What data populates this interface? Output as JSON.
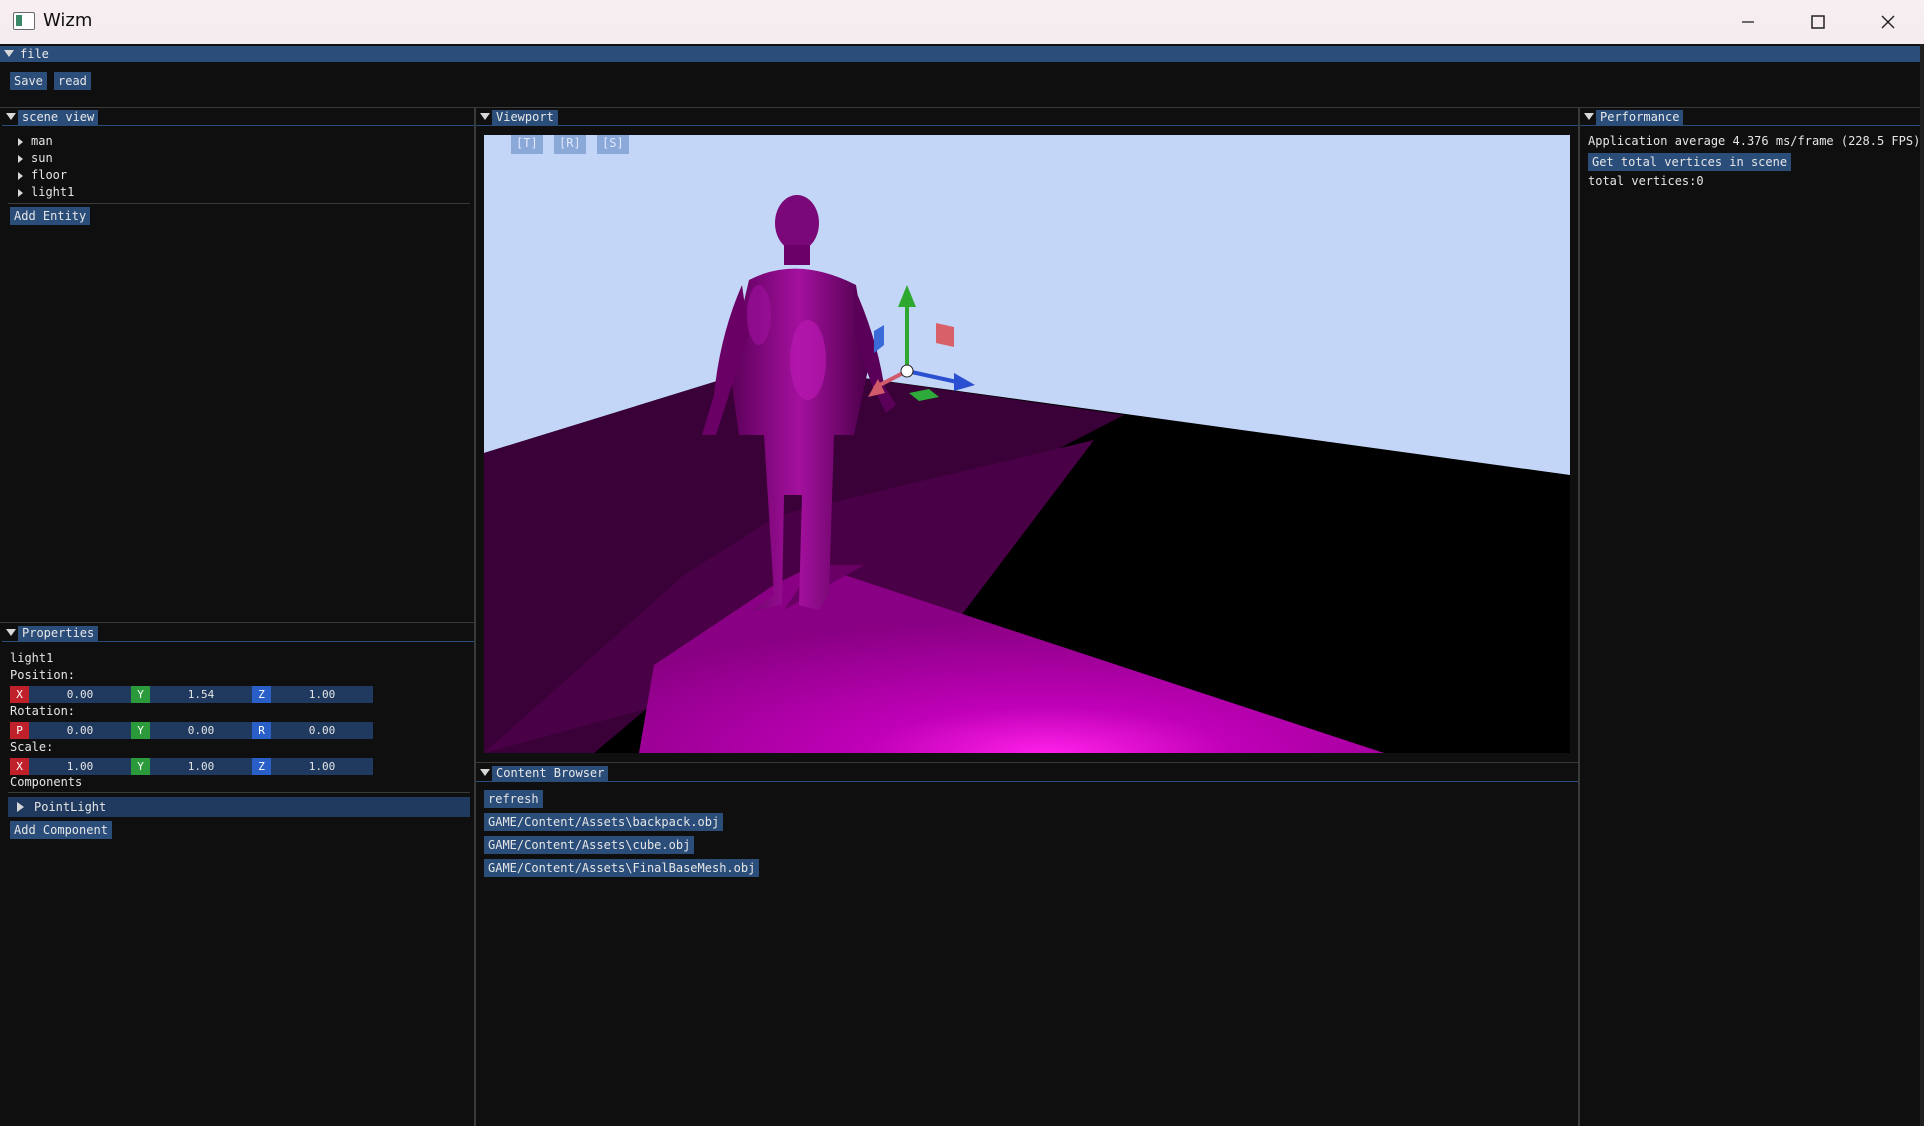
{
  "window": {
    "title": "Wizm",
    "minimize": "—",
    "maximize": "☐",
    "close": "✕"
  },
  "file_panel": {
    "header": "file",
    "save": "Save",
    "read": "read"
  },
  "scene_view": {
    "header": "scene view",
    "items": [
      "man",
      "sun",
      "floor",
      "light1"
    ],
    "add_entity": "Add Entity"
  },
  "properties": {
    "header": "Properties",
    "entity": "light1",
    "position_label": "Position:",
    "rotation_label": "Rotation:",
    "scale_label": "Scale:",
    "position": {
      "x_label": "X",
      "x": "0.00",
      "y_label": "Y",
      "y": "1.54",
      "z_label": "Z",
      "z": "1.00"
    },
    "rotation": {
      "p_label": "P",
      "p": "0.00",
      "y_label": "Y",
      "y": "0.00",
      "r_label": "R",
      "r": "0.00"
    },
    "scale": {
      "x_label": "X",
      "x": "1.00",
      "y_label": "Y",
      "y": "1.00",
      "z_label": "Z",
      "z": "1.00"
    },
    "components_label": "Components",
    "component": "PointLight",
    "add_component": "Add Component"
  },
  "viewport": {
    "header": "Viewport",
    "translate": "[T]",
    "rotate": "[R]",
    "scale": "[S]"
  },
  "content_browser": {
    "header": "Content Browser",
    "refresh": "refresh",
    "files": [
      "GAME/Content/Assets\\backpack.obj",
      "GAME/Content/Assets\\cube.obj",
      "GAME/Content/Assets\\FinalBaseMesh.obj"
    ]
  },
  "performance": {
    "header": "Performance",
    "average": "Application average 4.376 ms/frame (228.5 FPS)",
    "get_vertices": "Get total vertices in scene",
    "total_vertices": "total vertices:0"
  },
  "colors": {
    "accent": "#2a4d7a",
    "sky": "#c3d6f7",
    "floor_magenta": "#c800c0",
    "axis_x": "#c0202a",
    "axis_y": "#2a9a3a",
    "axis_z": "#2a5fc8"
  }
}
